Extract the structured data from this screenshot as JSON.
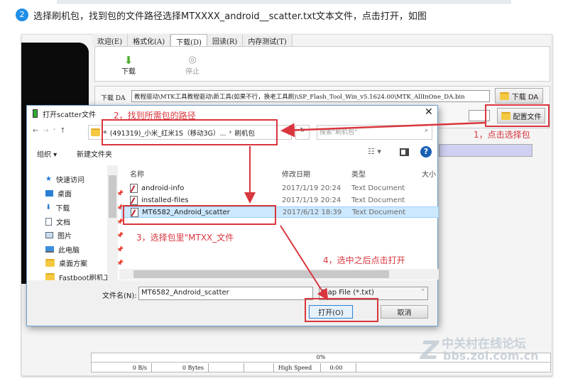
{
  "instruction": {
    "step": "2",
    "text": "选择刷机包，找到包的文件路径选择MTXXXX_android__scatter.txt文本文件，点击打开，如图"
  },
  "flash_tool": {
    "tabs": [
      "欢迎(E)",
      "格式化(A)",
      "下载(D)",
      "回读(R)",
      "内存测试(T)"
    ],
    "active_tab": "下载(D)",
    "download_label": "下载",
    "stop_label": "停止",
    "da_label": "下载 DA",
    "da_path": "教程驱动\\MTK工具教程驱动\\新工具(如果不行，换老工具刷)\\SP_Flash_Tool_Win_v5.1624.00\\MTK_AllInOne_DA.bin",
    "da_button": "下载 DA",
    "scatter_button": "配置文件",
    "progress": "0%",
    "status": [
      "0 B/s",
      "0 Bytes",
      "",
      "",
      "High Speed",
      "0:00"
    ]
  },
  "dialog": {
    "title": "打开scatter文件",
    "path_prefix": "«",
    "path": "(491319)_小米_红米1S（移动3G）...",
    "path_sep": "›",
    "path_current": "刷机包",
    "search_placeholder": "搜索\"刷机包\"",
    "organize": "组织 ▾",
    "new_folder": "新建文件夹",
    "nav_items": [
      {
        "label": "快速访问",
        "icon": "star-icon"
      },
      {
        "label": "桌面",
        "icon": "desktop-icon"
      },
      {
        "label": "下载",
        "icon": "download-icon"
      },
      {
        "label": "文档",
        "icon": "document-icon"
      },
      {
        "label": "图片",
        "icon": "picture-icon"
      },
      {
        "label": "此电脑",
        "icon": "computer-icon"
      },
      {
        "label": "桌面方案",
        "icon": "folder-icon"
      },
      {
        "label": "Fastboot刷机工",
        "icon": "folder-icon"
      }
    ],
    "columns": [
      "名称",
      "修改日期",
      "类型",
      "大小"
    ],
    "files": [
      {
        "name": "android-info",
        "date": "2017/1/19 20:24",
        "type": "Text Document"
      },
      {
        "name": "installed-files",
        "date": "2017/1/19 20:24",
        "type": "Text Document"
      },
      {
        "name": "MT6582_Android_scatter",
        "date": "2017/6/12 18:39",
        "type": "Text Document",
        "selected": true
      }
    ],
    "filename_label": "文件名(N):",
    "filename_value": "MT6582_Android_scatter",
    "filter_value": "Map File (*.txt)",
    "open_button": "打开(O)",
    "cancel_button": "取消"
  },
  "annotations": {
    "a1": "1，点击选择包",
    "a2": "2，找到所需包的路径",
    "a3": "3，选择包里\"MTXX_文件",
    "a4": "4，选中之后点击打开"
  },
  "watermark": {
    "line1": "中关村在线论坛",
    "line2": "bbs.zol.com.cn"
  },
  "colors": {
    "annotation": "#d9363e",
    "selection": "#cce8ff",
    "accent": "#1e8ee6"
  }
}
